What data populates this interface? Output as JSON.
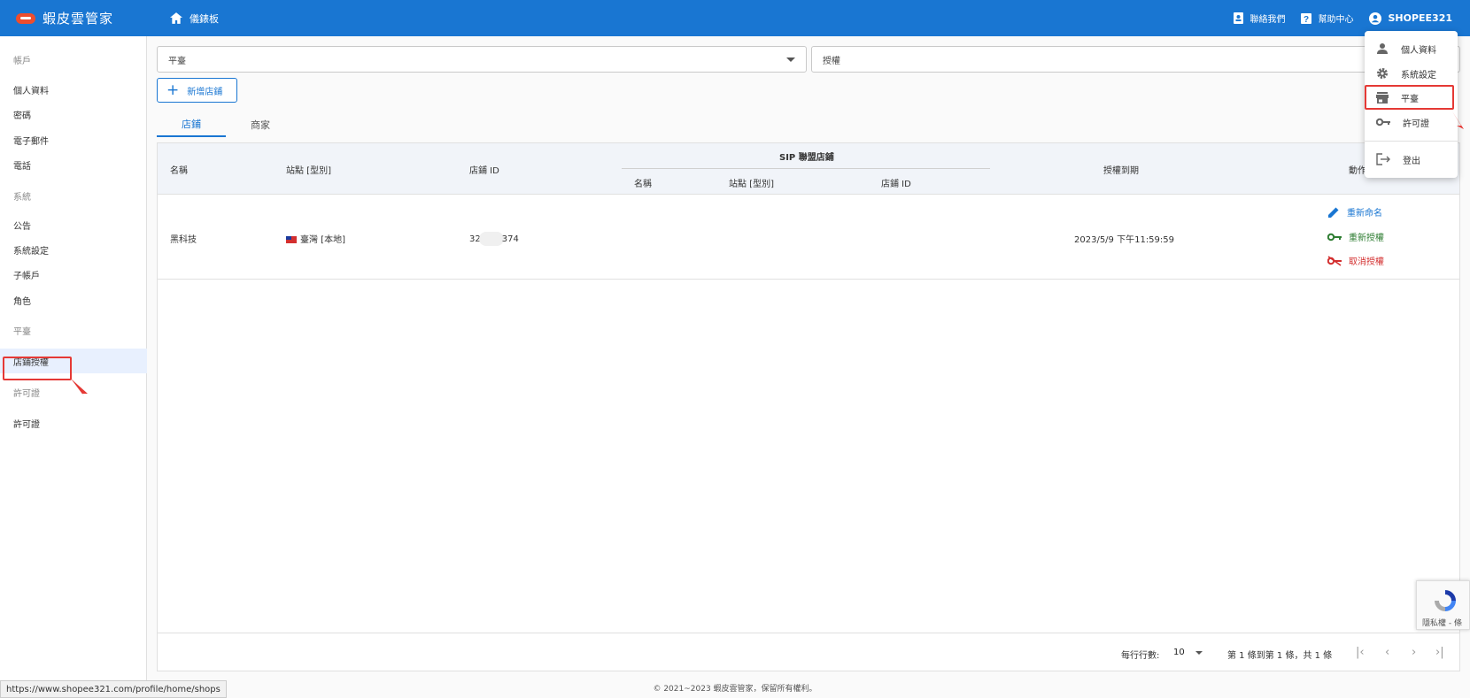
{
  "app": {
    "name": "蝦皮雲管家",
    "dashboard_label": "儀錶板"
  },
  "header": {
    "contact_label": "聯絡我們",
    "help_label": "幫助中心",
    "user_label": "SHOPEE321"
  },
  "sidebar": {
    "account_heading": "帳戶",
    "profile": "個人資料",
    "password": "密碼",
    "email": "電子郵件",
    "phone": "電話",
    "system_heading": "系統",
    "announcement": "公告",
    "system_settings": "系統設定",
    "sub_accounts": "子帳戶",
    "roles": "角色",
    "platform_heading": "平臺",
    "shop_authorization": "店鋪授權",
    "license_heading": "許可證",
    "license": "許可證"
  },
  "filters": {
    "platform_value": "平臺",
    "authorization_value": "授權"
  },
  "add_shop_label": "新增店鋪",
  "tabs": {
    "shops": "店鋪",
    "merchants": "商家"
  },
  "table": {
    "headers": {
      "name": "名稱",
      "site_type": "站點 [型別]",
      "shop_id": "店鋪 ID",
      "sip_group": "SIP 聯盟店鋪",
      "sip_name": "名稱",
      "sip_site_type": "站點 [型別]",
      "sip_shop_id": "店鋪 ID",
      "auth_expiry": "授權到期",
      "actions": "動作"
    },
    "rows": [
      {
        "name": "黑科技",
        "site": "臺灣 [本地]",
        "shop_id_prefix": "32",
        "shop_id_suffix": "374",
        "auth_expiry": "2023/5/9 下午11:59:59",
        "actions": {
          "rename": "重新命名",
          "reauthorize": "重新授權",
          "revoke": "取消授權"
        }
      }
    ]
  },
  "pagination": {
    "rows_per_page_label": "每行行數:",
    "rows_per_page": "10",
    "range_text": "第 1 條到第 1 條，共 1 條"
  },
  "footer": {
    "copyright": "© 2021~2023 蝦皮雲管家，保留所有權利。"
  },
  "status_url": "https://www.shopee321.com/profile/home/shops",
  "user_menu": {
    "profile": "個人資料",
    "system_settings": "系統設定",
    "platform": "平臺",
    "license": "許可證",
    "logout": "登出"
  },
  "recaptcha": {
    "text": "隱私權 - 條"
  },
  "colors": {
    "primary": "#1976d2",
    "highlight": "#e53935"
  }
}
